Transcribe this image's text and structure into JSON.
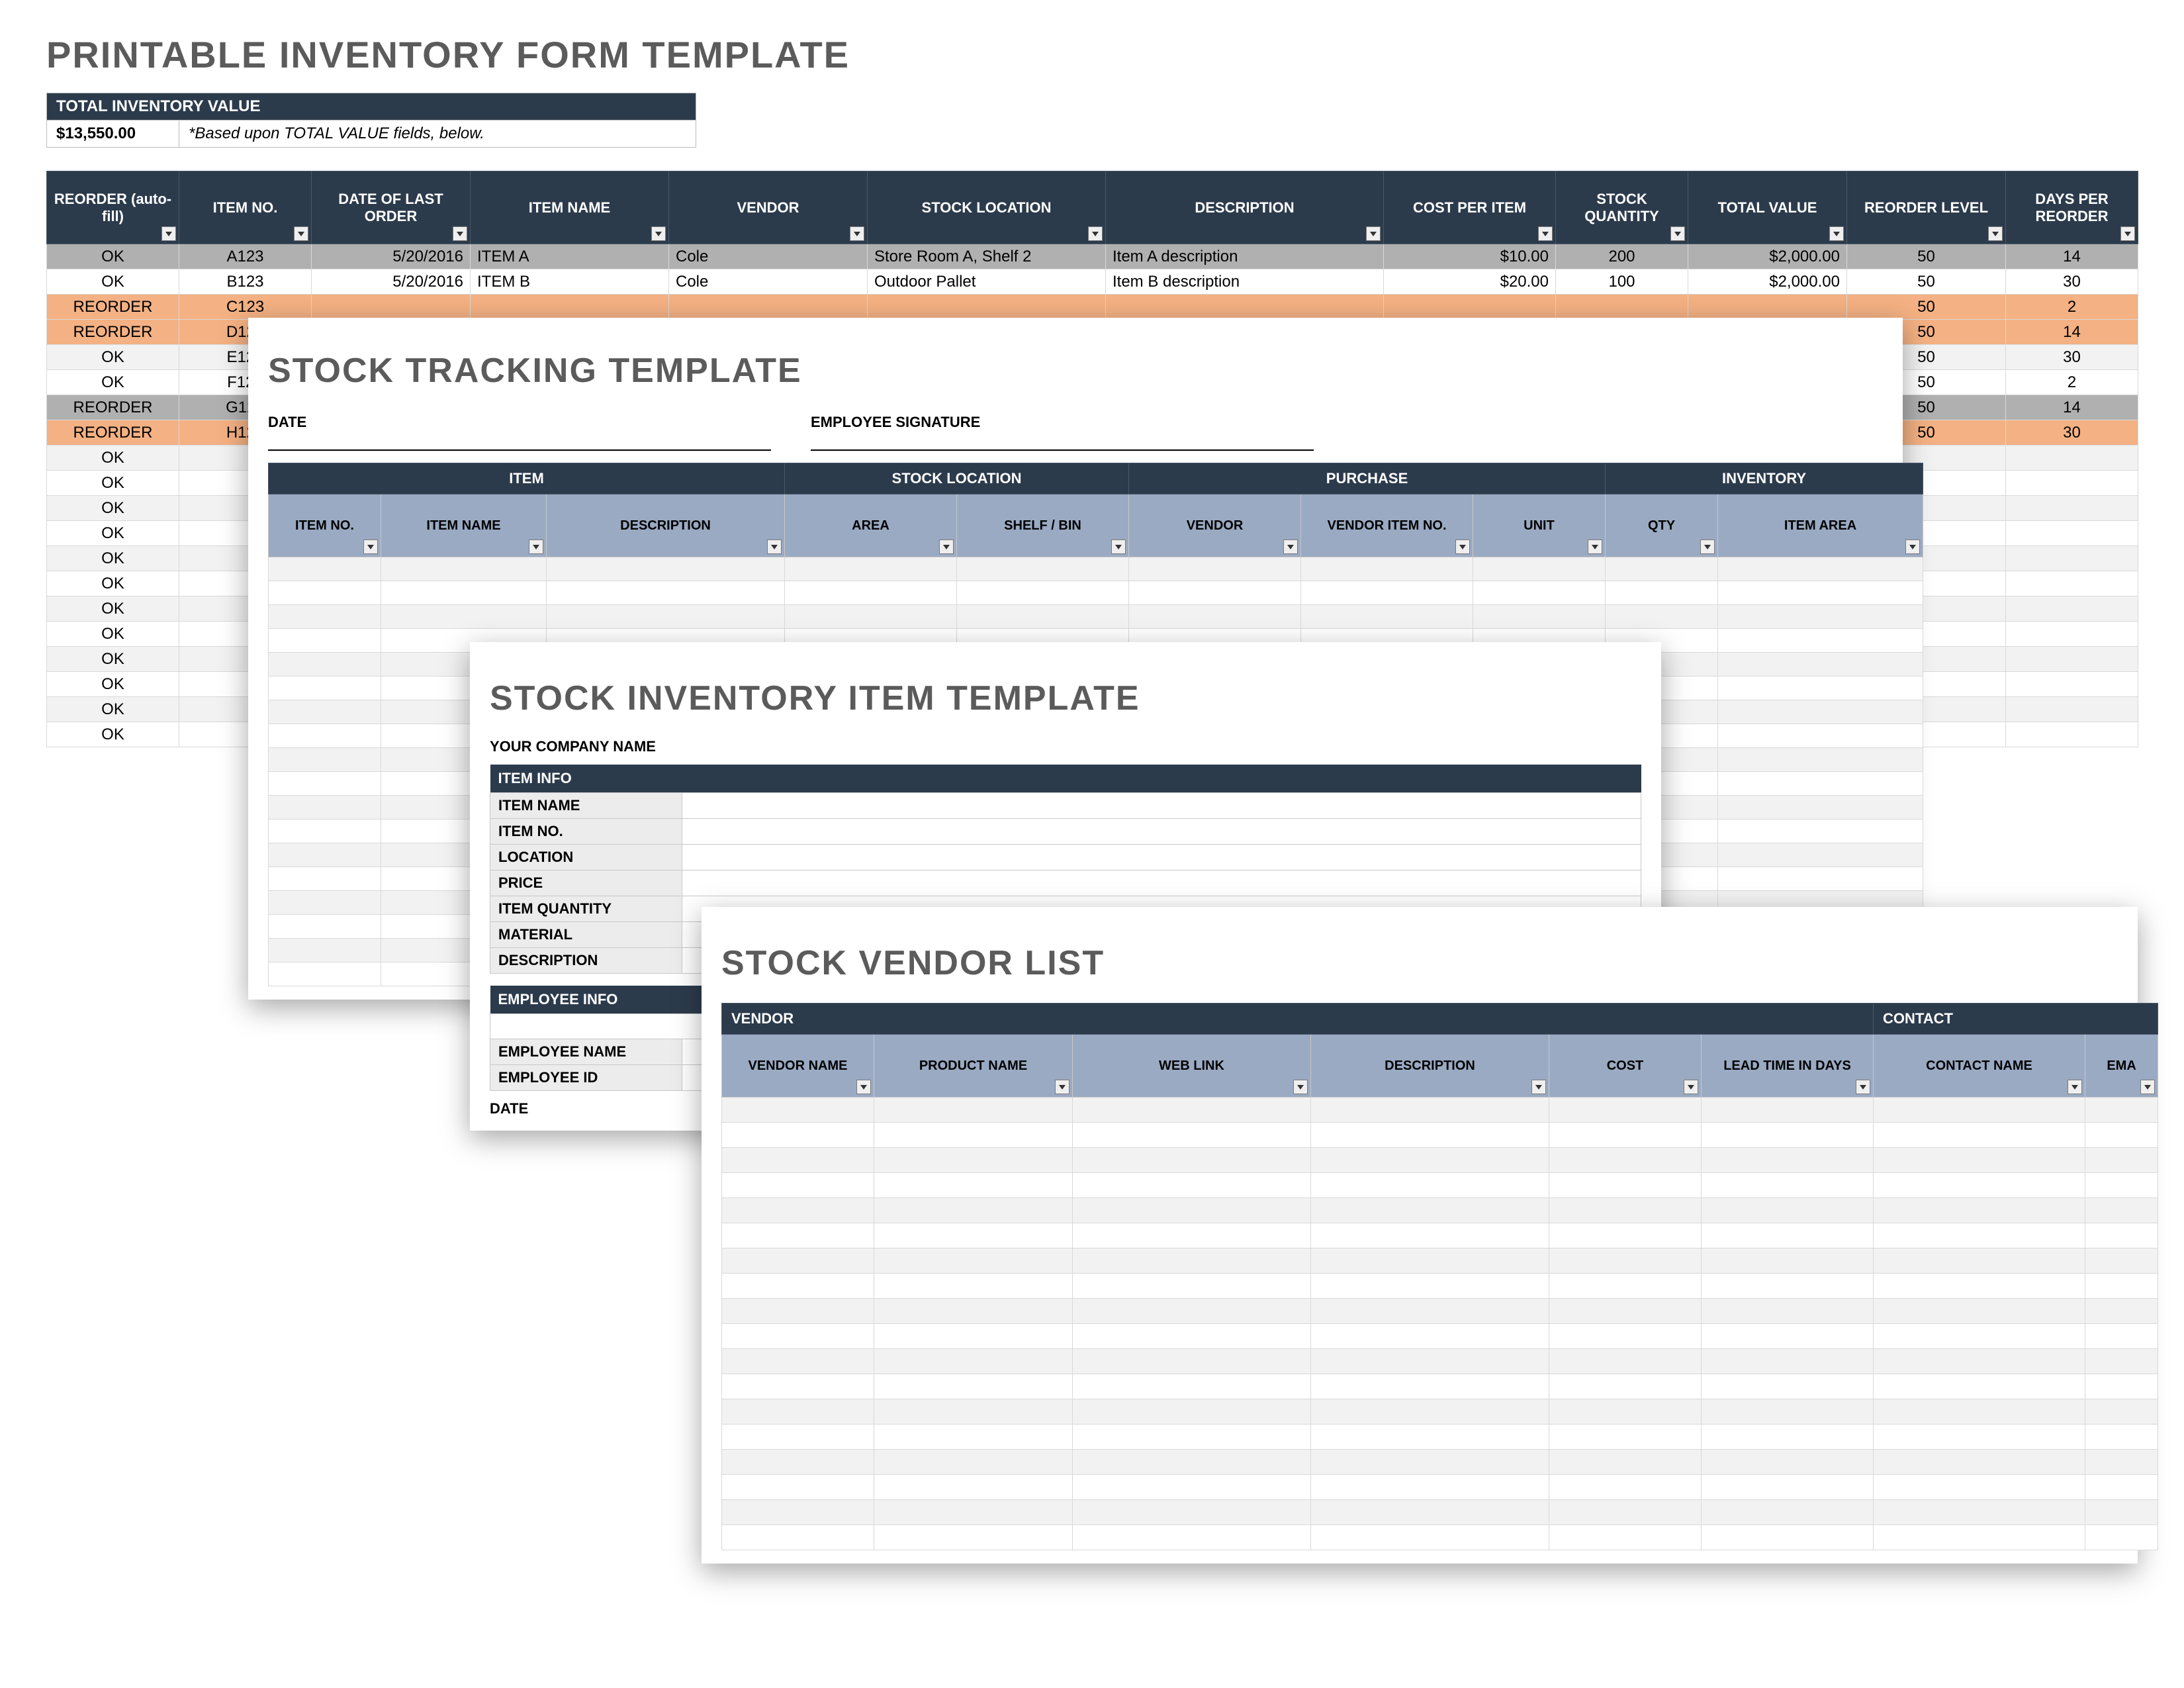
{
  "p1": {
    "title": "PRINTABLE INVENTORY FORM TEMPLATE",
    "tiv_label": "TOTAL INVENTORY VALUE",
    "tiv_value": "$13,550.00",
    "tiv_note": "*Based upon TOTAL VALUE fields, below.",
    "cols": [
      "REORDER (auto-fill)",
      "ITEM NO.",
      "DATE OF LAST ORDER",
      "ITEM NAME",
      "VENDOR",
      "STOCK LOCATION",
      "DESCRIPTION",
      "COST PER ITEM",
      "STOCK QUANTITY",
      "TOTAL VALUE",
      "REORDER LEVEL",
      "DAYS PER REORDER"
    ],
    "rows": [
      {
        "status": "grey",
        "reorder": "OK",
        "item": "A123",
        "date": "5/20/2016",
        "name": "ITEM A",
        "vendor": "Cole",
        "loc": "Store Room A, Shelf 2",
        "desc": "Item A description",
        "cost": "$10.00",
        "qty": "200",
        "total": "$2,000.00",
        "rl": "50",
        "dpr": "14"
      },
      {
        "status": "",
        "reorder": "OK",
        "item": "B123",
        "date": "5/20/2016",
        "name": "ITEM B",
        "vendor": "Cole",
        "loc": "Outdoor Pallet",
        "desc": "Item B description",
        "cost": "$20.00",
        "qty": "100",
        "total": "$2,000.00",
        "rl": "50",
        "dpr": "30"
      },
      {
        "status": "orange",
        "reorder": "REORDER",
        "item": "C123",
        "date": "",
        "name": "",
        "vendor": "",
        "loc": "",
        "desc": "",
        "cost": "",
        "qty": "",
        "total": "",
        "rl": "50",
        "dpr": "2"
      },
      {
        "status": "orange",
        "reorder": "REORDER",
        "item": "D123",
        "date": "",
        "name": "",
        "vendor": "",
        "loc": "",
        "desc": "",
        "cost": "",
        "qty": "",
        "total": "",
        "rl": "50",
        "dpr": "14"
      },
      {
        "status": "",
        "reorder": "OK",
        "item": "E123",
        "date": "",
        "name": "",
        "vendor": "",
        "loc": "",
        "desc": "",
        "cost": "",
        "qty": "",
        "total": "",
        "rl": "50",
        "dpr": "30"
      },
      {
        "status": "",
        "reorder": "OK",
        "item": "F123",
        "date": "",
        "name": "",
        "vendor": "",
        "loc": "",
        "desc": "",
        "cost": "",
        "qty": "",
        "total": "",
        "rl": "50",
        "dpr": "2"
      },
      {
        "status": "grey",
        "reorder": "REORDER",
        "item": "G123",
        "date": "",
        "name": "",
        "vendor": "",
        "loc": "",
        "desc": "",
        "cost": "",
        "qty": "",
        "total": "",
        "rl": "50",
        "dpr": "14"
      },
      {
        "status": "orange",
        "reorder": "REORDER",
        "item": "H123",
        "date": "",
        "name": "",
        "vendor": "",
        "loc": "",
        "desc": "",
        "cost": "",
        "qty": "",
        "total": "",
        "rl": "50",
        "dpr": "30"
      }
    ],
    "blank_ok_rows": 12
  },
  "p2": {
    "title": "STOCK TRACKING TEMPLATE",
    "date_label": "DATE",
    "sig_label": "EMPLOYEE SIGNATURE",
    "groups": [
      "ITEM",
      "STOCK LOCATION",
      "PURCHASE",
      "INVENTORY"
    ],
    "subcols": [
      "ITEM NO.",
      "ITEM NAME",
      "DESCRIPTION",
      "AREA",
      "SHELF / BIN",
      "VENDOR",
      "VENDOR ITEM NO.",
      "UNIT",
      "QTY",
      "ITEM AREA"
    ],
    "blank_rows": 18
  },
  "p3": {
    "title": "STOCK INVENTORY ITEM TEMPLATE",
    "company_label": "YOUR COMPANY NAME",
    "section_item": "ITEM INFO",
    "item_fields": [
      "ITEM NAME",
      "ITEM NO.",
      "LOCATION",
      "PRICE",
      "ITEM QUANTITY",
      "MATERIAL",
      "DESCRIPTION"
    ],
    "section_emp": "EMPLOYEE INFO",
    "emp_fields": [
      "EMPLOYEE NAME",
      "EMPLOYEE ID"
    ],
    "date_label": "DATE"
  },
  "p4": {
    "title": "STOCK VENDOR LIST",
    "groups": [
      "VENDOR",
      "CONTACT"
    ],
    "subcols": [
      "VENDOR NAME",
      "PRODUCT NAME",
      "WEB LINK",
      "DESCRIPTION",
      "COST",
      "LEAD TIME IN DAYS",
      "CONTACT NAME",
      "EMA"
    ],
    "blank_rows": 18
  }
}
